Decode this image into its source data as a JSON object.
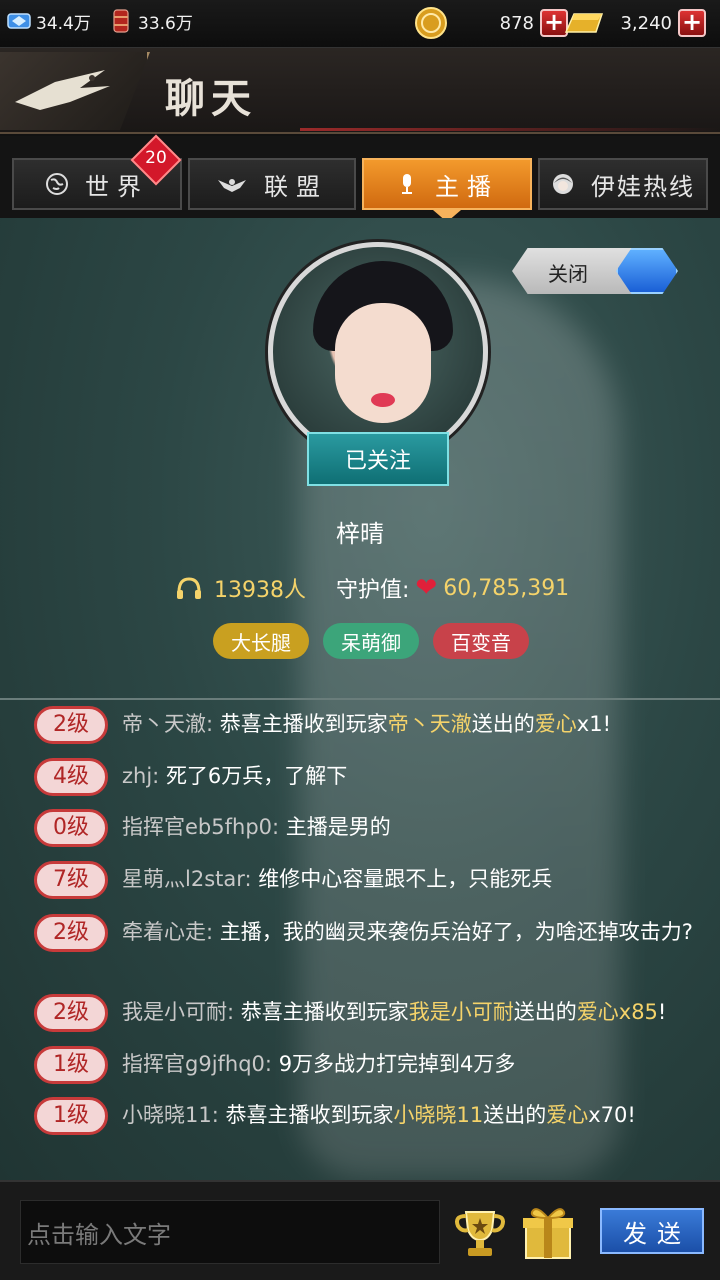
{
  "resources": {
    "diamond": "34.4万",
    "oil": "33.6万",
    "gold_coins": "878",
    "gold_bars": "3,240"
  },
  "header": {
    "title": "聊天"
  },
  "tabs": [
    {
      "label": "世界",
      "icon": "globe-icon",
      "badge": "20"
    },
    {
      "label": "联盟",
      "icon": "eagle-icon"
    },
    {
      "label": "主播",
      "icon": "microphone-icon",
      "active": true
    },
    {
      "label": "伊娃热线",
      "icon": "girl-icon"
    }
  ],
  "streamer": {
    "close_label": "关闭",
    "follow_label": "已关注",
    "name": "梓晴",
    "listeners": "13938人",
    "guard_label": "守护值:",
    "guard_value": "60,785,391",
    "tags": [
      {
        "label": "大长腿",
        "color": "#c9a020"
      },
      {
        "label": "呆萌御",
        "color": "#3ca57a"
      },
      {
        "label": "百变音",
        "color": "#c8424a"
      }
    ]
  },
  "chat": [
    {
      "level": "2级",
      "user": "帝丶天澈:",
      "parts": [
        [
          "恭喜主播收到玩家",
          false
        ],
        [
          "帝丶天澈",
          true
        ],
        [
          "送出的",
          false
        ],
        [
          "爱心",
          true
        ],
        [
          "x1",
          false
        ],
        [
          "!",
          false
        ]
      ]
    },
    {
      "level": "4级",
      "user": "zhj:",
      "parts": [
        [
          "死了6万兵，了解下",
          false
        ]
      ]
    },
    {
      "level": "0级",
      "user": "指挥官eb5fhp0:",
      "parts": [
        [
          "主播是男的",
          false
        ]
      ]
    },
    {
      "level": "7级",
      "user": "星萌灬l2star:",
      "parts": [
        [
          "维修中心容量跟不上，只能死兵",
          false
        ]
      ]
    },
    {
      "level": "2级",
      "user": "牵着心走:",
      "parts": [
        [
          "主播，我的幽灵来袭伤兵治好了，为啥还掉攻击力?",
          false
        ]
      ]
    },
    {
      "level": "2级",
      "user": "我是小可耐:",
      "parts": [
        [
          "恭喜主播收到玩家",
          false
        ],
        [
          "我是小可耐",
          true
        ],
        [
          "送出的",
          false
        ],
        [
          "爱心",
          true
        ],
        [
          "x85",
          true
        ],
        [
          "!",
          false
        ]
      ]
    },
    {
      "level": "1级",
      "user": "指挥官g9jfhq0:",
      "parts": [
        [
          "9万多战力打完掉到4万多",
          false
        ]
      ]
    },
    {
      "level": "1级",
      "user": "小晓晓11:",
      "parts": [
        [
          "恭喜主播收到玩家",
          false
        ],
        [
          "小晓晓11",
          true
        ],
        [
          "送出的",
          false
        ],
        [
          "爱心",
          true
        ],
        [
          "x70",
          false
        ],
        [
          "!",
          false
        ]
      ]
    }
  ],
  "bottom": {
    "placeholder": "点击输入文字",
    "send_label": "发送"
  }
}
